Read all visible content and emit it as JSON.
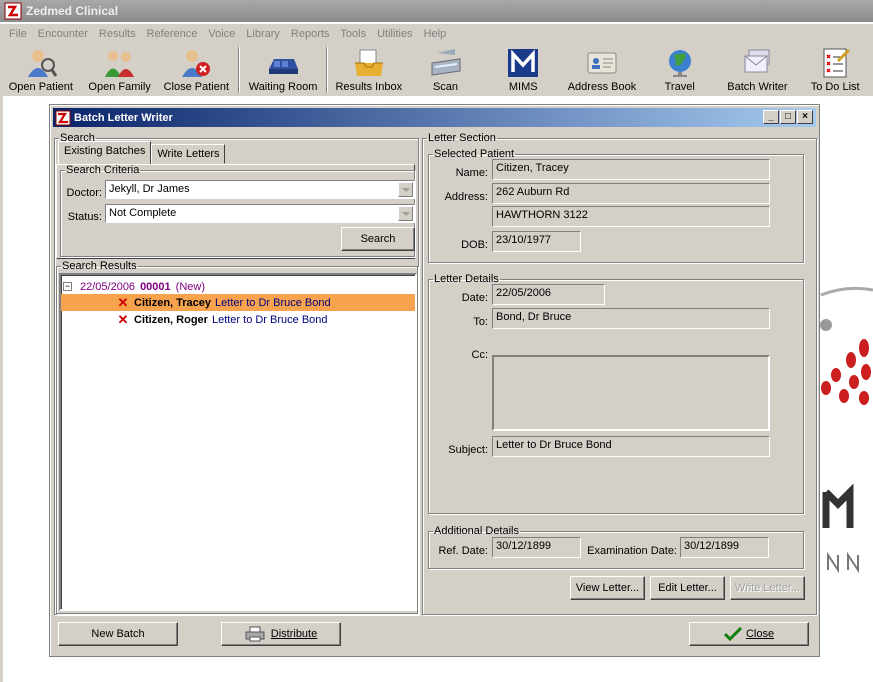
{
  "app": {
    "title": "Zedmed Clinical"
  },
  "menu": [
    "File",
    "Encounter",
    "Results",
    "Reference",
    "Voice",
    "Library",
    "Reports",
    "Tools",
    "Utilities",
    "Help"
  ],
  "toolbar": {
    "open_patient": "Open Patient",
    "open_family": "Open Family",
    "close_patient": "Close Patient",
    "waiting_room": "Waiting Room",
    "results_inbox": "Results Inbox",
    "scan": "Scan",
    "mims": "MIMS",
    "address_book": "Address Book",
    "travel": "Travel",
    "batch_writer": "Batch Writer",
    "todo_list": "To Do List"
  },
  "dialog": {
    "title": "Batch Letter Writer",
    "minimize": "_",
    "maximize": "□",
    "close": "×"
  },
  "search": {
    "legend": "Search",
    "tab_existing": "Existing Batches",
    "tab_write": "Write Letters",
    "criteria_legend": "Search Criteria",
    "doctor_label": "Doctor:",
    "doctor_value": "Jekyll, Dr James",
    "status_label": "Status:",
    "status_value": "Not Complete",
    "search_button": "Search",
    "results_legend": "Search Results"
  },
  "results": {
    "batch": {
      "expander": "−",
      "date": "22/05/2006",
      "number": "00001",
      "status": "(New)"
    },
    "items": [
      {
        "name": "Citizen, Tracey",
        "letter": "Letter to Dr Bruce Bond"
      },
      {
        "name": "Citizen, Roger",
        "letter": "Letter to Dr Bruce Bond"
      }
    ]
  },
  "letter": {
    "legend": "Letter Section",
    "patient_legend": "Selected Patient",
    "name_label": "Name:",
    "name_value": "Citizen, Tracey",
    "address_label": "Address:",
    "address_line1": "262 Auburn Rd",
    "address_line2": "HAWTHORN  3122",
    "dob_label": "DOB:",
    "dob_value": "23/10/1977",
    "details_legend": "Letter Details",
    "date_label": "Date:",
    "date_value": "22/05/2006",
    "to_label": "To:",
    "to_value": "Bond, Dr Bruce",
    "cc_label": "Cc:",
    "subject_label": "Subject:",
    "subject_value": "Letter to Dr Bruce Bond",
    "additional_legend": "Additional Details",
    "ref_date_label": "Ref. Date:",
    "ref_date_value": "30/12/1899",
    "exam_date_label": "Examination Date:",
    "exam_date_value": "30/12/1899",
    "view_button": "View Letter...",
    "edit_button": "Edit Letter...",
    "write_button": "Write Letter..."
  },
  "footer": {
    "new_batch": "New Batch",
    "distribute": "Distribute",
    "close": "Close"
  },
  "colors": {
    "selection": "#f7a24d",
    "title_bar_start": "#0a246a",
    "title_bar_end": "#a6caf0",
    "purple_text": "#800080",
    "navy_text": "#00007f",
    "delete_mark": "#d00000"
  }
}
